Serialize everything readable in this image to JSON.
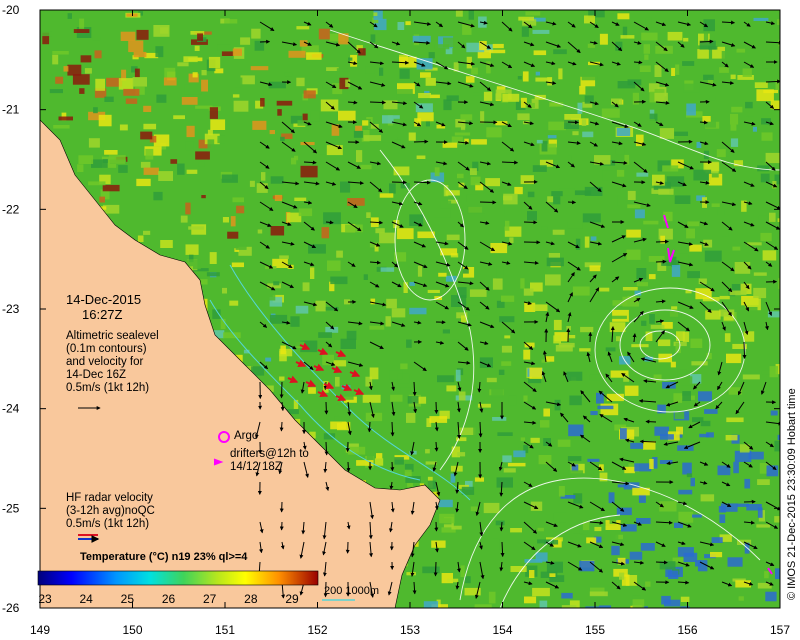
{
  "map": {
    "lat_ticks": [
      "-20",
      "-21",
      "-22",
      "-23",
      "-24",
      "-25",
      "-26"
    ],
    "lon_ticks": [
      "149",
      "150",
      "151",
      "152",
      "153",
      "154",
      "155",
      "156",
      "157"
    ],
    "credit": "© IMOS 21-Dec-2015 23:30:09 Hobart time",
    "colors": {
      "land": "#f9c89c",
      "ocean_mid": "#4fb92e",
      "warm": "#e0621c",
      "cool": "#3a7ad0",
      "contour": "#ffffff",
      "radar": "#dd1122"
    }
  },
  "legend": {
    "date": "14-Dec-2015",
    "time": "16:27Z",
    "altimetry": [
      "Altimetric sealevel",
      "(0.1m contours)",
      "and velocity for",
      "14-Dec 16Z",
      "0.5m/s (1kt 12h)"
    ],
    "argo_label": "Argo",
    "drifters": [
      "drifters@12h to",
      "14/12 18Z"
    ],
    "hf_radar": [
      "HF radar velocity",
      "(3-12h avg)noQC",
      "0.5m/s (1kt 12h)"
    ],
    "colorbar_title": "Temperature (°C) n19 23% ql>=4",
    "colorbar_ticks": [
      "23",
      "24",
      "25",
      "26",
      "27",
      "28",
      "29"
    ],
    "colorbar_range": [
      23,
      29
    ],
    "isobath_label": "200  1000m"
  }
}
